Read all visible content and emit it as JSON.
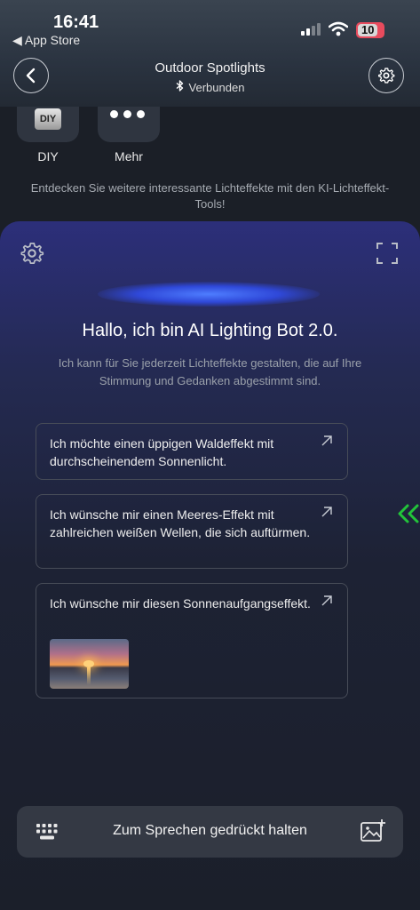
{
  "status_bar": {
    "time": "16:41",
    "back_app": "◀ App Store",
    "battery": "10",
    "battery_color": "#e84b5d"
  },
  "header": {
    "title": "Outdoor Spotlights",
    "connection_status": "Verbunden",
    "back_icon": "chevron-left-icon",
    "settings_icon": "gear-icon"
  },
  "tools": {
    "diy_icon_text": "DIY",
    "diy_label": "DIY",
    "more_label": "Mehr"
  },
  "tip_text": "Entdecken Sie weitere interessante Lichteffekte mit den KI-Lichteffekt-Tools!",
  "bot": {
    "title": "Hallo, ich bin AI Lighting Bot 2.0.",
    "description": "Ich kann für Sie jederzeit Lichteffekte gestalten, die auf Ihre Stimmung und Gedanken abgestimmt sind.",
    "accent_color": "#3f6bff",
    "suggestions": [
      {
        "text": "Ich möchte einen üppigen Waldeffekt mit durchscheinendem Sonnenlicht."
      },
      {
        "text": "Ich wünsche mir einen Meeres-Effekt mit zahlreichen weißen Wellen, die sich auftürmen."
      },
      {
        "text": "Ich wünsche mir diesen Sonnenaufgangseffekt."
      }
    ]
  },
  "input_bar": {
    "label": "Zum Sprechen gedrückt halten",
    "keyboard_icon": "keyboard-icon",
    "image_icon": "add-image-icon"
  },
  "side_handle_color": "#22c43a"
}
